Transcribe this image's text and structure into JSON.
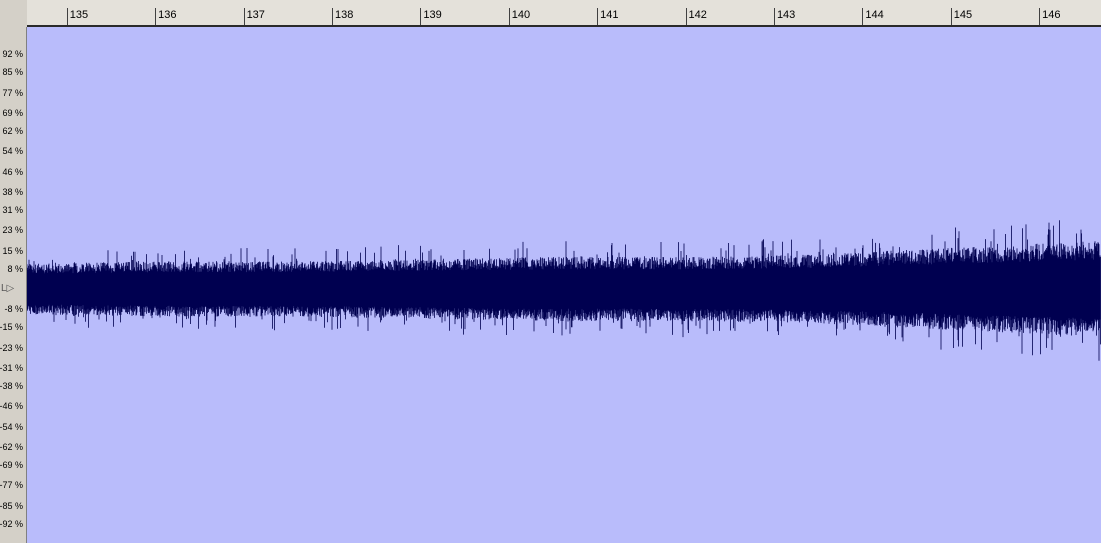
{
  "timeline": {
    "ticks": [
      "135",
      "136",
      "137",
      "138",
      "139",
      "140",
      "141",
      "142",
      "143",
      "144",
      "145",
      "146"
    ],
    "start": 134.55,
    "end": 146.7
  },
  "amplitude_scale": {
    "labels": [
      "92 %",
      "85 %",
      "77 %",
      "69 %",
      "62 %",
      "54 %",
      "46 %",
      "38 %",
      "31 %",
      "23 %",
      "15 %",
      "8 %",
      "-8 %",
      "-15 %",
      "-23 %",
      "-31 %",
      "-38 %",
      "-46 %",
      "-54 %",
      "-62 %",
      "-69 %",
      "-77 %",
      "-85 %",
      "-92 %"
    ],
    "values": [
      92,
      85,
      77,
      69,
      62,
      54,
      46,
      38,
      31,
      23,
      15,
      8,
      -8,
      -15,
      -23,
      -31,
      -38,
      -46,
      -54,
      -62,
      -69,
      -77,
      -85,
      -92
    ],
    "playhead_marker": "L▷"
  },
  "waveform": {
    "background_color": "#b9bcfb",
    "wave_color": "#000050",
    "envelope": [
      {
        "time": 134.55,
        "amplitude": 11
      },
      {
        "time": 136.0,
        "amplitude": 12
      },
      {
        "time": 137.5,
        "amplitude": 12
      },
      {
        "time": 139.0,
        "amplitude": 13
      },
      {
        "time": 140.5,
        "amplitude": 14
      },
      {
        "time": 142.0,
        "amplitude": 14
      },
      {
        "time": 143.5,
        "amplitude": 15
      },
      {
        "time": 145.0,
        "amplitude": 18
      },
      {
        "time": 146.7,
        "amplitude": 21
      }
    ]
  }
}
